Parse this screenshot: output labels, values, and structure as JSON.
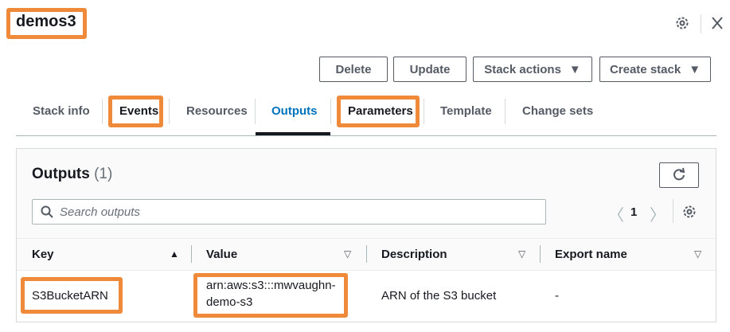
{
  "header": {
    "title": "demos3",
    "settings_icon": "gear-icon",
    "close_icon": "close-icon"
  },
  "actions": {
    "delete": "Delete",
    "update": "Update",
    "stack_actions": "Stack actions",
    "create_stack": "Create stack",
    "caret": "▼"
  },
  "tabs": [
    {
      "label": "Stack info"
    },
    {
      "label": "Events"
    },
    {
      "label": "Resources"
    },
    {
      "label": "Outputs",
      "active": true
    },
    {
      "label": "Parameters"
    },
    {
      "label": "Template"
    },
    {
      "label": "Change sets"
    }
  ],
  "outputs": {
    "title": "Outputs",
    "count": "(1)",
    "search_placeholder": "Search outputs",
    "page": "1",
    "columns": [
      "Key",
      "Value",
      "Description",
      "Export name"
    ],
    "rows": [
      {
        "key": "S3BucketARN",
        "value_line1": "arn:aws:s3:::mwvaughn-",
        "value_line2": "demo-s3",
        "description": "ARN of the S3 bucket",
        "export_name": "-"
      }
    ]
  },
  "colors": {
    "highlight": "#ee8a3a",
    "active_tab": "#0073bb"
  }
}
